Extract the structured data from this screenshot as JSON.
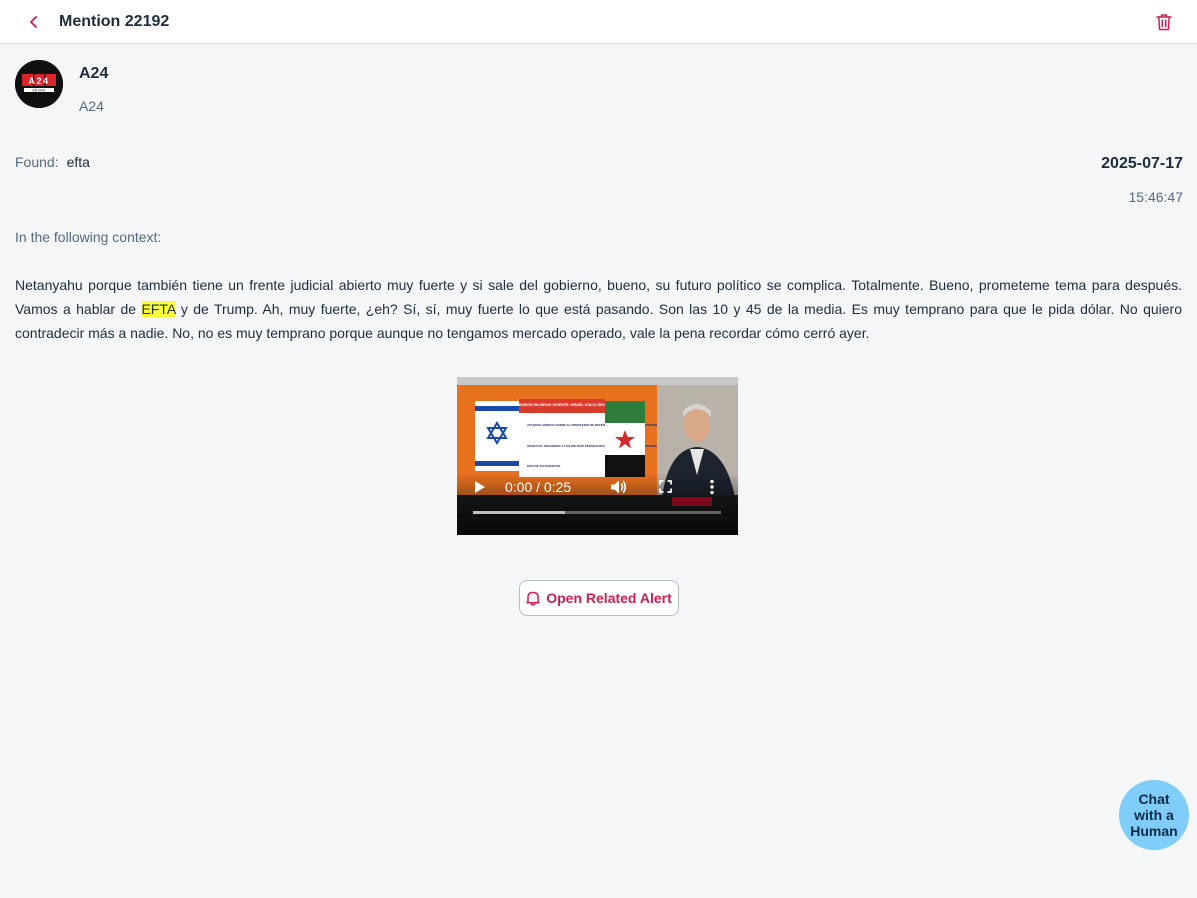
{
  "header": {
    "title": "Mention 22192",
    "back_icon": "chevron-left-icon",
    "delete_icon": "trash-icon"
  },
  "author": {
    "name": "A24",
    "handle": "A24",
    "logo_text": "A 2 4",
    "logo_subtext": "EN VIVO"
  },
  "found": {
    "label": "Found:",
    "term": "efta"
  },
  "timestamp": {
    "date": "2025-07-17",
    "time": "15:46:47"
  },
  "context": {
    "label": "In the following context:",
    "text_before": "Netanyahu porque también tiene un frente judicial abierto muy fuerte y si sale del gobierno, bueno, su futuro político se complica. Totalmente. Bueno, prometeme tema para después. Vamos a hablar de ",
    "highlight": "EFTA",
    "text_after": " y de Trump. Ah, muy fuerte, ¿eh? Sí, sí, muy fuerte lo que está pasando. Son las 10 y 45 de la media. Es muy temprano para que le pida dólar. No quiero contradecir más a nadie. No, no es muy temprano porque aunque no tengamos mercado operado, vale la pena recordar cómo cerró ayer."
  },
  "video": {
    "time_display": "0:00 / 0:25",
    "progress": 0.37,
    "overlay_title": "TENSIÓN EN MEDIO ORIENTE: ISRAEL ATACÓ SIRIA",
    "overlay_items": [
      "ATAQUES AÉREOS SOBRE EL MINISTERIO DE DEFENSA Y CERCA DEL PALACIO PRESIDENCIAL",
      "OBJETIVO: DEFENDER A LOS DRUSOS PERSEGUIDOS POR LAS FUERZAS GUBERNAMENTALES",
      "MÁS DE 300 MUERTOS"
    ]
  },
  "actions": {
    "open_alert_label": "Open Related Alert",
    "open_alert_icon": "bell-icon"
  },
  "chat": {
    "label": "Chat with a Human"
  },
  "colors": {
    "accent": "#cc1f53",
    "highlight": "#ffff3a",
    "chat_bubble": "#7fcdf8",
    "background": "#f5f6f8"
  }
}
